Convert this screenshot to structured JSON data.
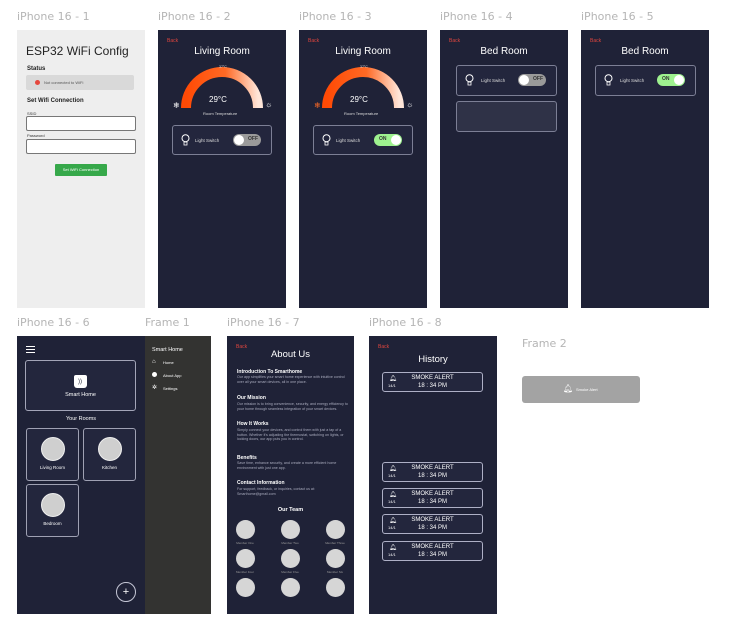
{
  "frame_labels": {
    "f1": "iPhone 16 - 1",
    "f2": "iPhone 16 - 2",
    "f3": "iPhone 16 - 3",
    "f4": "iPhone 16 - 4",
    "f5": "iPhone 16 - 5",
    "f6": "iPhone 16 - 6",
    "frame1": "Frame 1",
    "f7": "iPhone 16 - 7",
    "f8": "iPhone 16 - 8",
    "frame2": "Frame 2"
  },
  "esp": {
    "title": "ESP32 WiFi Config",
    "status_heading": "Status",
    "status_text": "Not connected to WiFi",
    "set_heading": "Set Wifi Connection",
    "ssid_label": "SSID",
    "password_label": "Password",
    "button": "Set WiFi Connection"
  },
  "living": {
    "back": "Back",
    "title": "Living Room",
    "gauge_max": "37°C",
    "temp": "29°C",
    "temp_label": "Room Temperature",
    "temp_fraction": 0.78,
    "switch_label": "Light Switch",
    "off": "OFF",
    "on": "ON"
  },
  "bed": {
    "back": "Back",
    "title": "Bed Room",
    "switch_label": "Light Switch",
    "off": "OFF",
    "on": "ON"
  },
  "home": {
    "card_title": "Smart Home",
    "your_rooms": "Your Rooms",
    "rooms": [
      "Living Room",
      "Kitchen",
      "Bedroom"
    ],
    "plus": "+"
  },
  "drawer": {
    "title": "Smart Home",
    "items": [
      "Home",
      "About App",
      "Settings"
    ]
  },
  "about": {
    "back": "Back",
    "title": "About Us",
    "sections": [
      {
        "h": "Introduction To Smarthome",
        "t": "Our app simplifies your smart home experience with intuitive control over all your smart devices, all in one place."
      },
      {
        "h": "Our Mission",
        "t": "Our mission is to bring convenience, security, and energy efficiency to your home through seamless integration of your smart devices."
      },
      {
        "h": "How It Works",
        "t": "Simply connect your devices, and control them with just a tap of a button. Whether it's adjusting the thermostat, switching on lights, or locking doors, our app puts you in control."
      },
      {
        "h": "Benefits",
        "t": "Save time, enhance security, and create a more efficient home environment with just one app."
      },
      {
        "h": "Contact Information",
        "t": "For support, feedback, or inquiries, contact us at: Smarthome@gmail.com"
      }
    ],
    "team_heading": "Our Team",
    "team": [
      "Member One",
      "Member Two",
      "Member Three",
      "Member Four",
      "Member Five",
      "Member Six"
    ]
  },
  "history": {
    "back": "Back",
    "title": "History",
    "alert": "SMOKE ALERT",
    "time": "18 : 34 PM",
    "date": "14/1"
  },
  "frame2": {
    "label": "Smoke Alert"
  }
}
